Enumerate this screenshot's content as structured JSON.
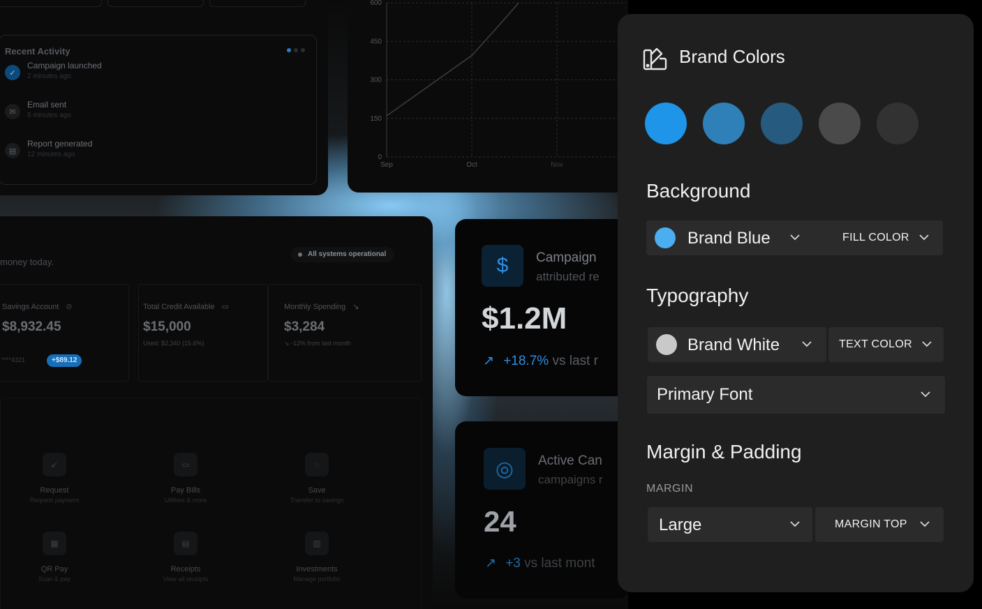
{
  "activity": {
    "title": "Recent Activity",
    "items": [
      {
        "label": "Campaign launched",
        "time": "2 minutes ago",
        "icon": "check-icon"
      },
      {
        "label": "Email sent",
        "time": "5 minutes ago",
        "icon": "mail-icon"
      },
      {
        "label": "Report generated",
        "time": "12 minutes ago",
        "icon": "report-icon"
      }
    ]
  },
  "chart_data": {
    "type": "line",
    "x": [
      "Sep",
      "Oct",
      "Nov"
    ],
    "yticks": [
      0,
      150,
      300,
      450,
      600
    ],
    "ylim": [
      0,
      600
    ],
    "series": [
      {
        "values": [
          160,
          395,
          600
        ]
      }
    ],
    "grid": true
  },
  "dashboard": {
    "greeting": "money today.",
    "status": "All systems operational",
    "stats": [
      {
        "label": "Savings Account",
        "value": "$8,932.45",
        "icon": "eye-off-icon"
      },
      {
        "label": "Total Credit Available",
        "value": "$15,000",
        "sub": "Used: $2,340 (15.6%)",
        "icon": "card-icon"
      },
      {
        "label": "Monthly Spending",
        "value": "$3,284",
        "sub": "↘ -12% from last month",
        "icon": "trend-down-icon"
      }
    ],
    "account_number": "****4321",
    "account_change": "+$89.12",
    "actions": [
      {
        "title": "Request",
        "sub": "Request payment"
      },
      {
        "title": "Pay Bills",
        "sub": "Utilities & more"
      },
      {
        "title": "Save",
        "sub": "Transfer to savings"
      },
      {
        "title": "QR Pay",
        "sub": "Scan & pay"
      },
      {
        "title": "Receipts",
        "sub": "View all receipts"
      },
      {
        "title": "Investments",
        "sub": "Manage portfolio"
      }
    ]
  },
  "metrics": [
    {
      "title": "Campaign",
      "subtitle": "attributed re",
      "value": "$1.2M",
      "delta": "+18.7%",
      "delta_suffix": "vs last r",
      "icon": "dollar-icon"
    },
    {
      "title": "Active Can",
      "subtitle": "campaigns r",
      "value": "24",
      "delta": "+3",
      "delta_suffix": "vs last mont",
      "icon": "target-icon"
    }
  ],
  "panel": {
    "title": "Brand Colors",
    "swatches": [
      "#1e95e8",
      "#2f7fb8",
      "#265a7e",
      "#4a4a4b",
      "#323233"
    ],
    "background_title": "Background",
    "background_color_name": "Brand Blue",
    "background_color": "#4aaef0",
    "background_mode": "FILL COLOR",
    "typography_title": "Typography",
    "text_color_name": "Brand White",
    "text_color": "#c9c9c9",
    "text_mode": "TEXT COLOR",
    "font_select": "Primary Font",
    "margin_title": "Margin & Padding",
    "margin_label": "MARGIN",
    "margin_size": "Large",
    "margin_side": "MARGIN TOP"
  }
}
